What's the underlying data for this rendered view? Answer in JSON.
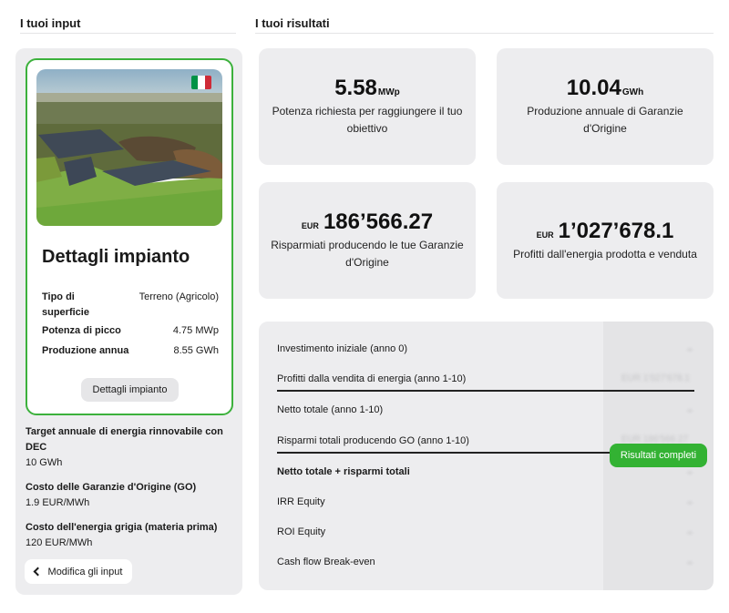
{
  "inputs_section": {
    "title": "I tuoi input"
  },
  "results_section": {
    "title": "I tuoi risultati"
  },
  "plant_card": {
    "flag_colors": [
      "#009246",
      "#ffffff",
      "#ce2b37"
    ],
    "title": "Dettagli impianto",
    "details": [
      {
        "label": "Tipo di superficie",
        "value": "Terreno (Agricolo)"
      },
      {
        "label": "Potenza di picco",
        "value": "4.75 MWp"
      },
      {
        "label": "Produzione annua",
        "value": "8.55 GWh"
      }
    ],
    "button_label": "Dettagli impianto"
  },
  "params": [
    {
      "label": "Target annuale di energia rinnovabile con DEC",
      "value": "10 GWh"
    },
    {
      "label": "Costo delle Garanzie d'Origine (GO)",
      "value": "1.9 EUR/MWh"
    },
    {
      "label": "Costo dell'energia grigia (materia prima)",
      "value": "120 EUR/MWh"
    }
  ],
  "edit_button_label": "Modifica gli input",
  "results": [
    {
      "value": "5.58",
      "unit": "MWp",
      "label": "Potenza richiesta per raggiungere il tuo obiettivo"
    },
    {
      "value": "10.04",
      "unit": "GWh",
      "label": "Produzione annuale di Garanzie d'Origine"
    },
    {
      "value": "186’566.27",
      "currency": "EUR",
      "label": "Risparmiati producendo le tue Garanzie d'Origine"
    },
    {
      "value": "1’027’678.1",
      "currency": "EUR",
      "label": "Profitti dall'energia prodotta e venduta"
    }
  ],
  "table": {
    "rows": [
      {
        "label": "Investimento iniziale (anno 0)"
      },
      {
        "label": "Profitti dalla vendita di energia (anno 1-10)",
        "blurred_value": "EUR 1'027'678.1"
      },
      {
        "label": "Netto totale (anno 1-10)"
      },
      {
        "label": "Risparmi totali producendo GO (anno 1-10)",
        "blurred_value": "EUR 186'566.27"
      },
      {
        "label": "Netto totale + risparmi totali"
      },
      {
        "label": "IRR Equity"
      },
      {
        "label": "ROI Equity"
      },
      {
        "label": "Cash flow Break-even"
      }
    ],
    "cta_label": "Risultati completi"
  },
  "colors": {
    "accent_green": "#33b233",
    "card_bg": "#ededef"
  }
}
